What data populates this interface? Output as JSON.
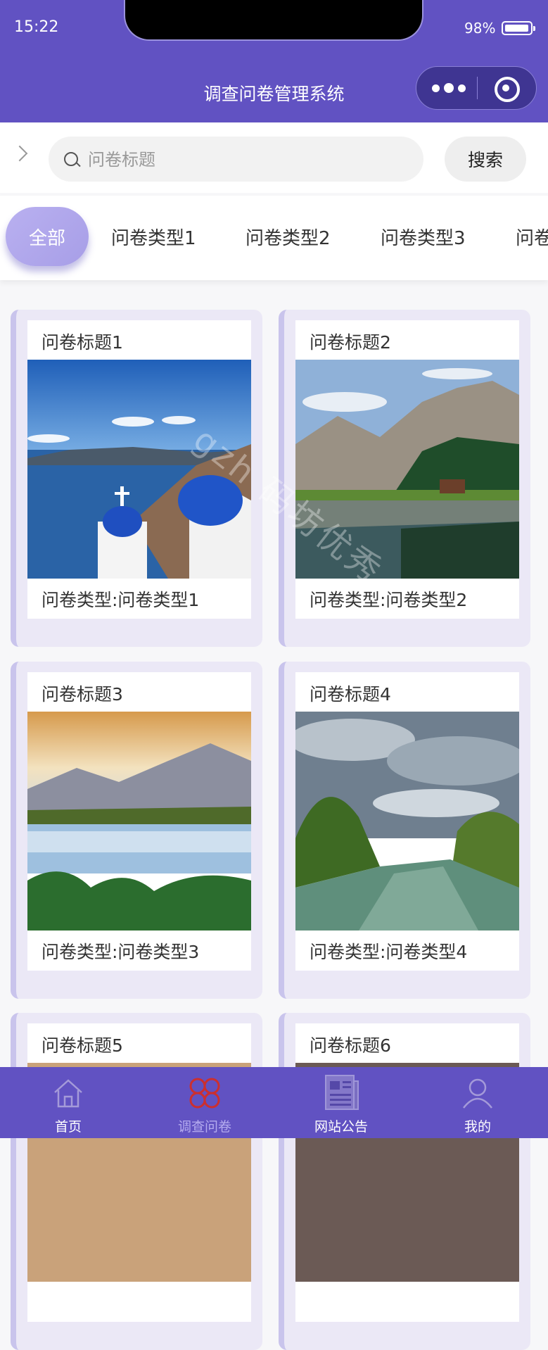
{
  "status_bar": {
    "time": "15:22",
    "battery": "98%"
  },
  "header": {
    "title": "调查问卷管理系统"
  },
  "search": {
    "placeholder": "问卷标题",
    "button_label": "搜索"
  },
  "tabs": [
    "全部",
    "问卷类型1",
    "问卷类型2",
    "问卷类型3",
    "问卷"
  ],
  "cards": [
    {
      "title": "问卷标题1",
      "type": "问卷类型:问卷类型1",
      "image": "santorini-domes"
    },
    {
      "title": "问卷标题2",
      "type": "问卷类型:问卷类型2",
      "image": "mountain-lake-cabin"
    },
    {
      "title": "问卷标题3",
      "type": "问卷类型:问卷类型3",
      "image": "sunrise-mountain-lake"
    },
    {
      "title": "问卷标题4",
      "type": "问卷类型:问卷类型4",
      "image": "river-cloudy-sky"
    },
    {
      "title": "问卷标题5",
      "type": "",
      "image": "partial"
    },
    {
      "title": "问卷标题6",
      "type": "",
      "image": "partial"
    }
  ],
  "watermark": "gzh 码坊优秀",
  "bottom_nav": [
    {
      "label": "首页",
      "icon": "home-icon",
      "active": false
    },
    {
      "label": "调查问卷",
      "icon": "clover-icon",
      "active": true
    },
    {
      "label": "网站公告",
      "icon": "newspaper-icon",
      "active": false
    },
    {
      "label": "我的",
      "icon": "user-icon",
      "active": false
    }
  ],
  "colors": {
    "primary": "#6152c2",
    "active_nav": "#cc2f2f",
    "card_bg": "#ebe8f6"
  }
}
